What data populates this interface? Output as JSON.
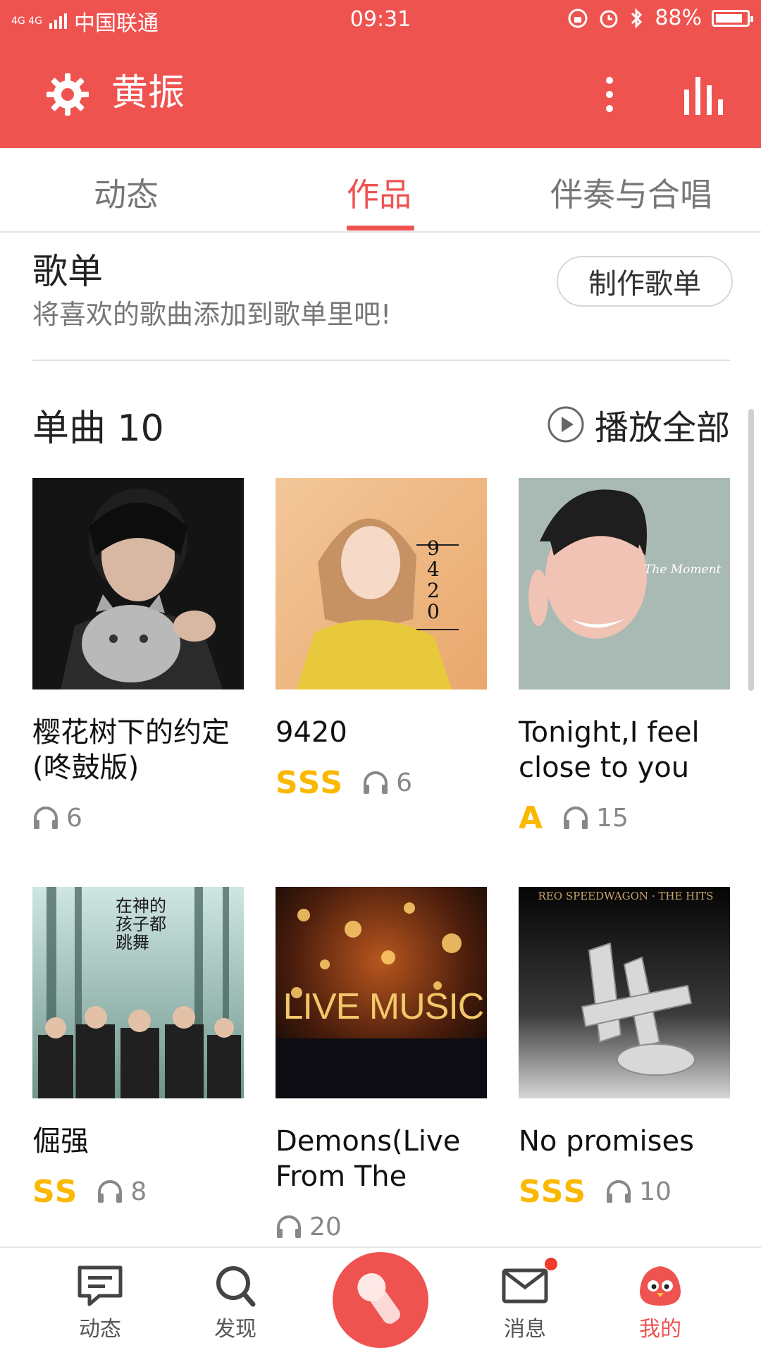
{
  "status": {
    "network": "4G 4G",
    "carrier": "中国联通",
    "time": "09:31",
    "battery": "88%",
    "battery_level": 0.88
  },
  "header": {
    "title": "黄振"
  },
  "tabs": [
    {
      "label": "动态",
      "active": false
    },
    {
      "label": "作品",
      "active": true
    },
    {
      "label": "伴奏与合唱",
      "active": false
    }
  ],
  "playlist": {
    "title": "歌单",
    "subtitle": "将喜欢的歌曲添加到歌单里吧!",
    "create_label": "制作歌单"
  },
  "songs": {
    "header": "单曲 10",
    "play_all_label": "播放全部",
    "items": [
      {
        "name": "樱花树下的约定(咚鼓版)",
        "grade": "",
        "plays": "6",
        "cover_text": ""
      },
      {
        "name": "9420",
        "grade": "SSS",
        "plays": "6",
        "cover_text": "9420"
      },
      {
        "name": "Tonight,I feel close to you",
        "grade": "A",
        "plays": "15",
        "cover_text": "The Moment"
      },
      {
        "name": "倔强",
        "grade": "SS",
        "plays": "8",
        "cover_text": "在神的孩子都跳舞"
      },
      {
        "name": "Demons(Live From The",
        "grade": "",
        "plays": "20",
        "cover_text": "LIVE MUSIC"
      },
      {
        "name": "No promises",
        "grade": "SSS",
        "plays": "10",
        "cover_text": "REO SPEEDWAGON · THE HITS"
      }
    ]
  },
  "nav": [
    {
      "label": "动态",
      "icon": "feed-icon",
      "active": false
    },
    {
      "label": "发现",
      "icon": "search-icon",
      "active": false
    },
    {
      "label": "",
      "icon": "microphone-icon",
      "active": false
    },
    {
      "label": "消息",
      "icon": "mail-icon",
      "active": false,
      "badge": true
    },
    {
      "label": "我的",
      "icon": "bird-mascot-icon",
      "active": true
    }
  ],
  "colors": {
    "brand": "#ef5350",
    "grade": "#fbb800"
  }
}
